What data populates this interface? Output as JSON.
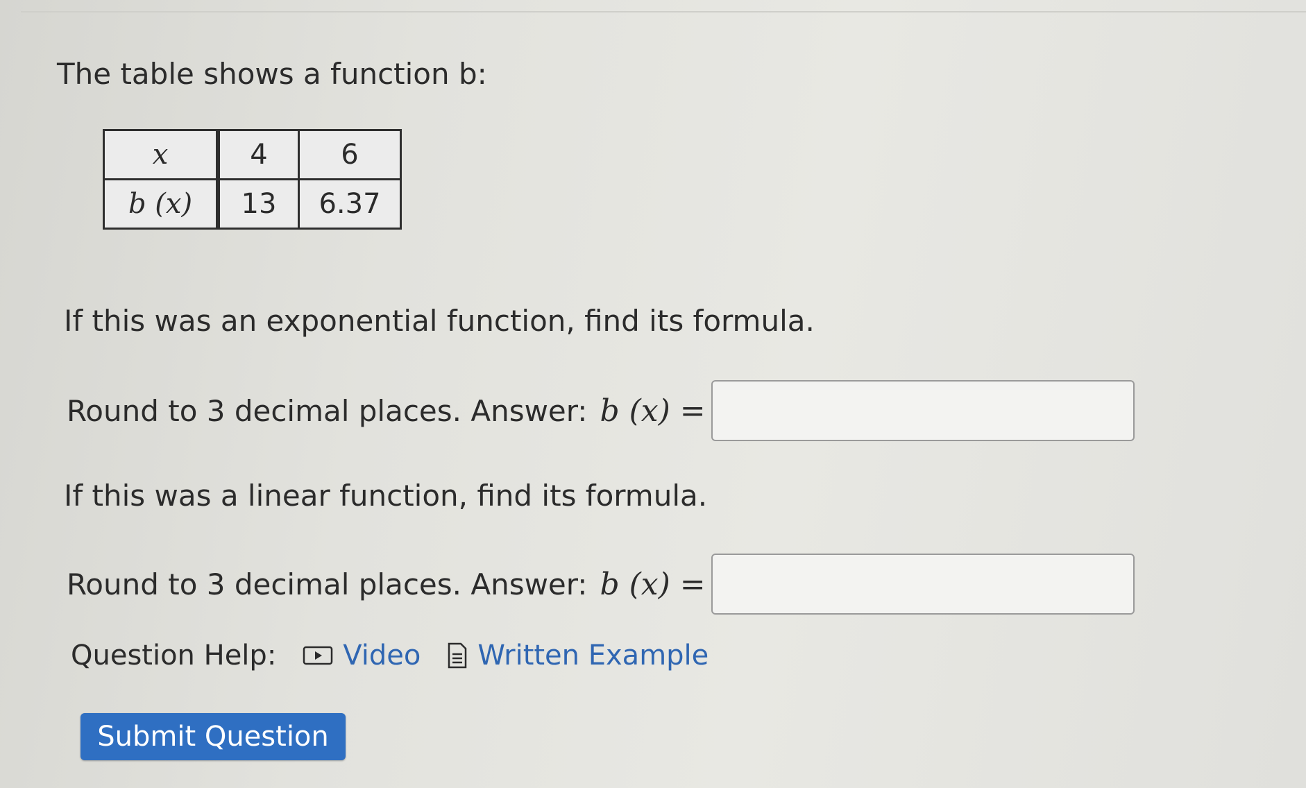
{
  "question": {
    "intro": "The table shows a function b:",
    "table": {
      "header_label": "x",
      "row_label": "b (x)",
      "x_values": [
        "4",
        "6"
      ],
      "b_values": [
        "13",
        "6.37"
      ]
    },
    "exponential_prompt": "If this was an exponential function, find its formula.",
    "round_instruction_1": "Round to 3 decimal places. Answer:",
    "answer_lhs_1": "b (x) =",
    "answer_value_1": "",
    "linear_prompt": "If this was a linear function, find its formula.",
    "round_instruction_2": "Round to 3 decimal places. Answer:",
    "answer_lhs_2": "b (x) =",
    "answer_value_2": ""
  },
  "help": {
    "label": "Question Help:",
    "video_label": "Video",
    "video_icon": "play-video-icon",
    "example_label": "Written Example",
    "example_icon": "document-icon",
    "link_color": "#2f66b2"
  },
  "submit": {
    "label": "Submit Question",
    "color": "#2f6fc2"
  }
}
